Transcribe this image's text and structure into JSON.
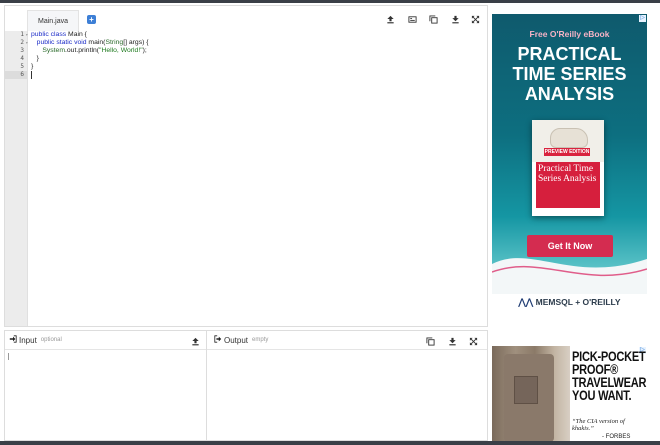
{
  "editor": {
    "tab_label": "Main.java",
    "add_tab_label": "+",
    "line_numbers": [
      "1",
      "2",
      "3",
      "4",
      "5",
      "6"
    ],
    "code": {
      "line1_kw": "public class",
      "line1_rest": " Main {",
      "line2_indent": "   ",
      "line2_kw": "public static void",
      "line2_fn": " main",
      "line2_paren": "(",
      "line2_type": "String",
      "line2_rest": "[] args) {",
      "line3_indent": "      ",
      "line3_fn": "System",
      "line3_mid": ".out.println(",
      "line3_str": "\"Hello, World!\"",
      "line3_end": ");",
      "line4": "   }",
      "line5": "}"
    },
    "toolbar_icons": [
      "upload-icon",
      "settings-icon",
      "copy-icon",
      "download-icon",
      "expand-icon"
    ]
  },
  "input": {
    "title": "Input",
    "subtitle": "optional"
  },
  "output": {
    "title": "Output",
    "subtitle": "empty"
  },
  "ad1": {
    "badge": "▷",
    "free_text": "Free O'Reilly eBook",
    "title_line1": "PRACTICAL",
    "title_line2": "TIME SERIES",
    "title_line3": "ANALYSIS",
    "book_preview": "PREVIEW EDITION",
    "book_title": "Practical Time Series Analysis",
    "cta": "Get It Now",
    "footer_brand": "MEMSQL",
    "footer_sep": " + ",
    "footer_partner": "O'REILLY",
    "colors": {
      "background_top": "#0f5a6d",
      "cta": "#d42c50",
      "accent": "#f6b3c6"
    }
  },
  "ad2": {
    "badge": "▷",
    "headline_1": "PICK-POCKET",
    "headline_2": "PROOF®",
    "headline_3": "TRAVELWEAR",
    "headline_4": "YOU WANT.",
    "quote": "“The CIA version of khakis.”",
    "attribution": "- FORBES"
  }
}
